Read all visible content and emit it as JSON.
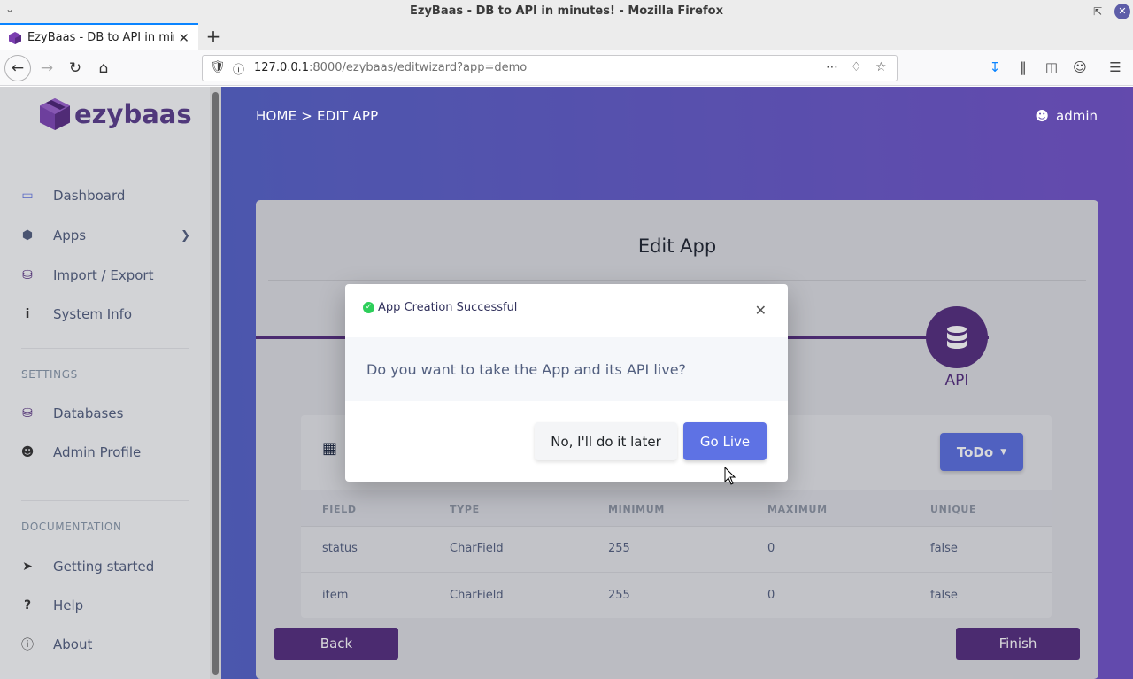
{
  "browser": {
    "window_title": "EzyBaas - DB to API in minutes! - Mozilla Firefox",
    "tab_title": "EzyBaas - DB to API in minutes!",
    "url_host": "127.0.0.1",
    "url_rest": ":8000/ezybaas/editwizard?app=demo"
  },
  "sidebar": {
    "brand": "ezybaas",
    "items": [
      {
        "label": "Dashboard",
        "icon": "monitor-icon"
      },
      {
        "label": "Apps",
        "icon": "cube-icon"
      },
      {
        "label": "Import / Export",
        "icon": "database-icon"
      },
      {
        "label": "System Info",
        "icon": "info-icon"
      }
    ],
    "settings_label": "SETTINGS",
    "settings_items": [
      {
        "label": "Databases",
        "icon": "database-icon"
      },
      {
        "label": "Admin Profile",
        "icon": "user-icon"
      }
    ],
    "documentation_label": "DOCUMENTATION",
    "doc_items": [
      {
        "label": "Getting started",
        "icon": "rocket-icon"
      },
      {
        "label": "Help",
        "icon": "question-icon"
      },
      {
        "label": "About",
        "icon": "info-circle-icon"
      }
    ]
  },
  "header": {
    "breadcrumb": "HOME > EDIT APP",
    "user": "admin"
  },
  "card": {
    "title": "Edit App",
    "step_label": "API",
    "model_button": "ToDo",
    "table": {
      "columns": [
        "FIELD",
        "TYPE",
        "MINIMUM",
        "MAXIMUM",
        "UNIQUE"
      ],
      "rows": [
        [
          "status",
          "CharField",
          "255",
          "0",
          "false"
        ],
        [
          "item",
          "CharField",
          "255",
          "0",
          "false"
        ]
      ]
    },
    "back_label": "Back",
    "finish_label": "Finish"
  },
  "modal": {
    "title": "App Creation Successful",
    "question": "Do you want to take the App and its API live?",
    "later_label": "No, I'll do it later",
    "live_label": "Go Live"
  },
  "colors": {
    "primary": "#5e72e4",
    "brand_purple": "#542d7e",
    "success": "#2dce5a"
  }
}
